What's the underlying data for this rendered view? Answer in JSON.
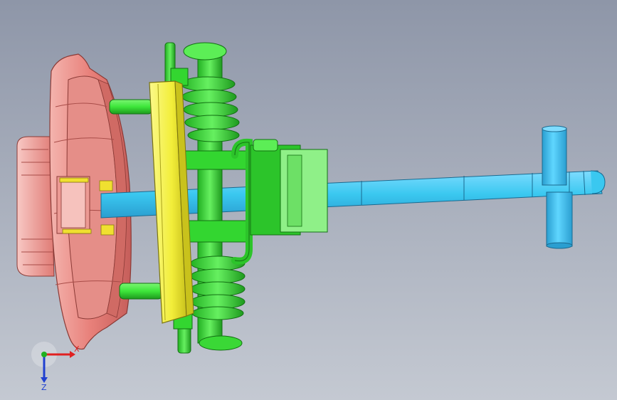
{
  "viewport": {
    "background_top": "#8e96a8",
    "background_bottom": "#c4c9d2"
  },
  "parts": {
    "housing_color": "#e8807a",
    "bracket_color": "#f2ee3a",
    "spring_color": "#3de63a",
    "shaft_color": "#3ac8f0",
    "tab_color": "#f0e030"
  },
  "triad": {
    "x_label": "X",
    "z_label": "Z",
    "x_color": "#e02020",
    "y_color": "#20b020",
    "z_color": "#2040d0"
  }
}
